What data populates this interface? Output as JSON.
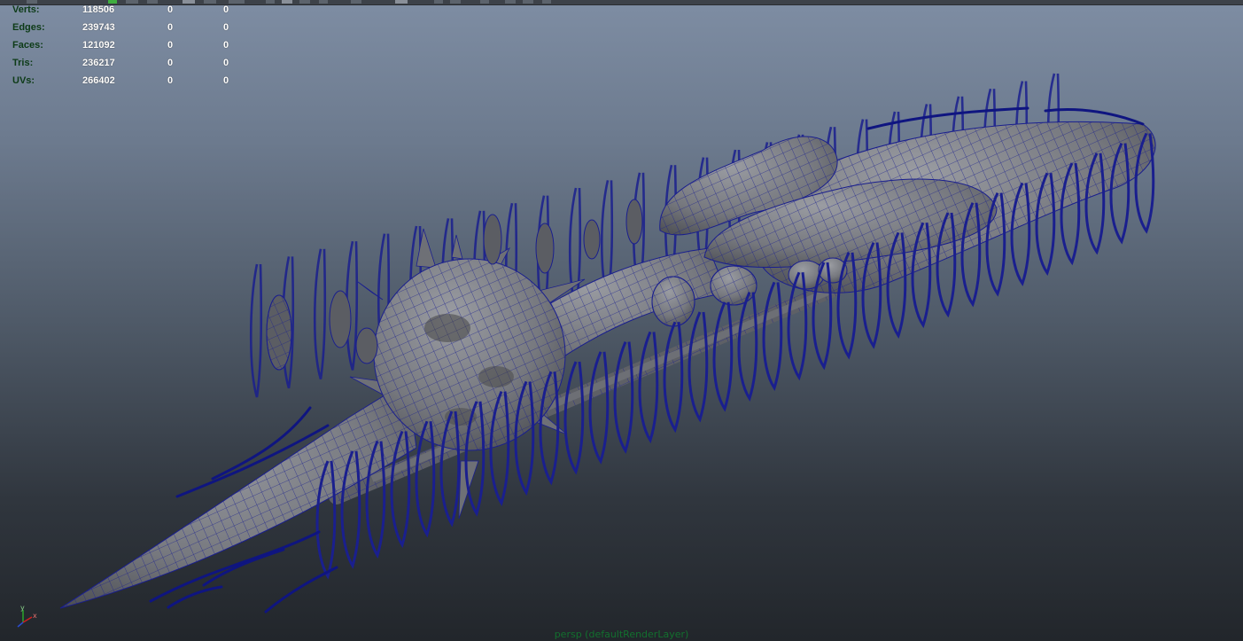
{
  "hud": {
    "rows": [
      {
        "label": "Verts:",
        "total": "118506",
        "selected": "0",
        "component": "0"
      },
      {
        "label": "Edges:",
        "total": "239743",
        "selected": "0",
        "component": "0"
      },
      {
        "label": "Faces:",
        "total": "121092",
        "selected": "0",
        "component": "0"
      },
      {
        "label": "Tris:",
        "total": "236217",
        "selected": "0",
        "component": "0"
      },
      {
        "label": "UVs:",
        "total": "266402",
        "selected": "0",
        "component": "0"
      }
    ]
  },
  "viewport": {
    "camera_label": "persp (defaultRenderLayer)",
    "axis": {
      "x": "x",
      "y": "y",
      "z": "z"
    }
  },
  "colors": {
    "wireframe": "#1a1f8e",
    "shaded_mesh": "#7c7e84",
    "hud_label": "#0d3b17",
    "camera_label": "#12702e",
    "gradient_top": "#7e8da3",
    "gradient_bottom": "#22262b"
  },
  "icons": [
    "toolbar-button-icon",
    "axis-gizmo-icon"
  ]
}
